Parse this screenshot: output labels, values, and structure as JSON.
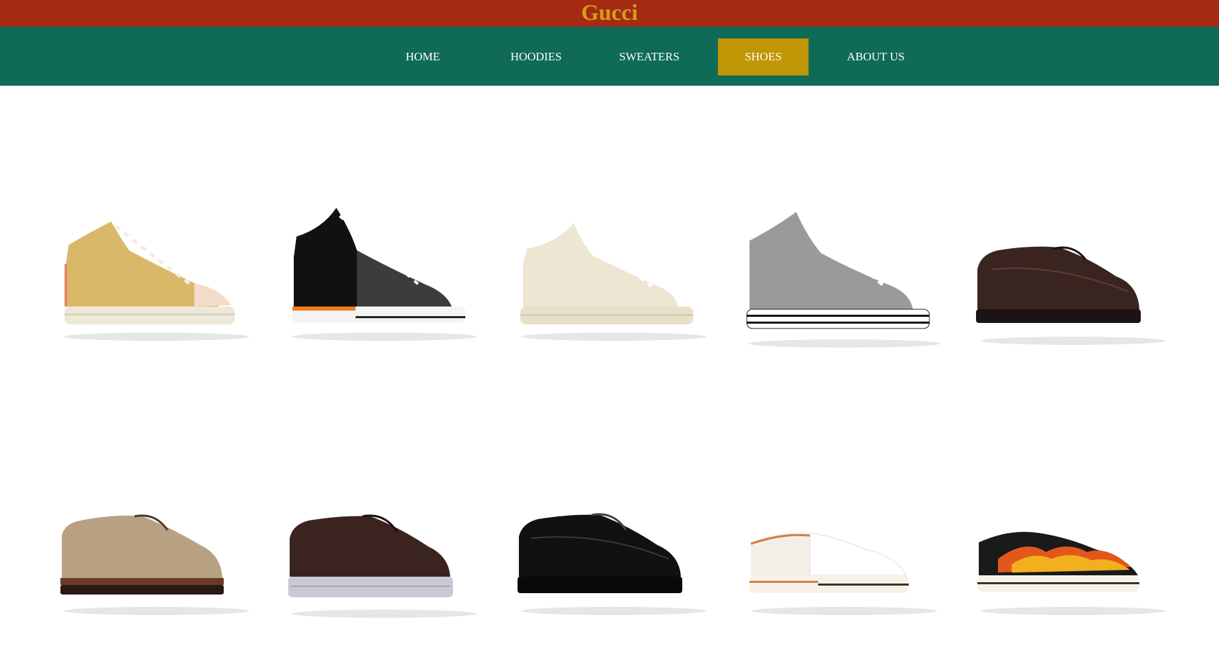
{
  "brand": {
    "title": "Gucci"
  },
  "nav": {
    "items": [
      {
        "label": "HOME",
        "active": false
      },
      {
        "label": "HOODIES",
        "active": false
      },
      {
        "label": "SWEATERS",
        "active": false
      },
      {
        "label": "SHOES",
        "active": true
      },
      {
        "label": "ABOUT US",
        "active": false
      }
    ]
  },
  "colors": {
    "brand_bar": "#a52a14",
    "brand_text": "#d4a017",
    "nav_bar": "#0f6b57",
    "nav_active": "#c09506"
  },
  "products": [
    {
      "icon": "tan-high-top-sneaker-icon",
      "color": "#d9b86a"
    },
    {
      "icon": "black-grey-high-top-sneaker-icon",
      "color": "#1a1a1a"
    },
    {
      "icon": "cream-high-top-sneaker-icon",
      "color": "#ede6d2"
    },
    {
      "icon": "grey-high-top-sneaker-icon",
      "color": "#9a9a9a"
    },
    {
      "icon": "brown-leather-derby-shoe-icon",
      "color": "#3a2420"
    },
    {
      "icon": "suede-derby-shoe-icon",
      "color": "#b8a182"
    },
    {
      "icon": "brown-derby-clear-sole-shoe-icon",
      "color": "#3b241f"
    },
    {
      "icon": "black-leather-derby-shoe-icon",
      "color": "#111111"
    },
    {
      "icon": "white-low-top-sneaker-icon",
      "color": "#f3efe6"
    },
    {
      "icon": "flame-low-top-sneaker-icon",
      "color": "#e2581c"
    }
  ]
}
